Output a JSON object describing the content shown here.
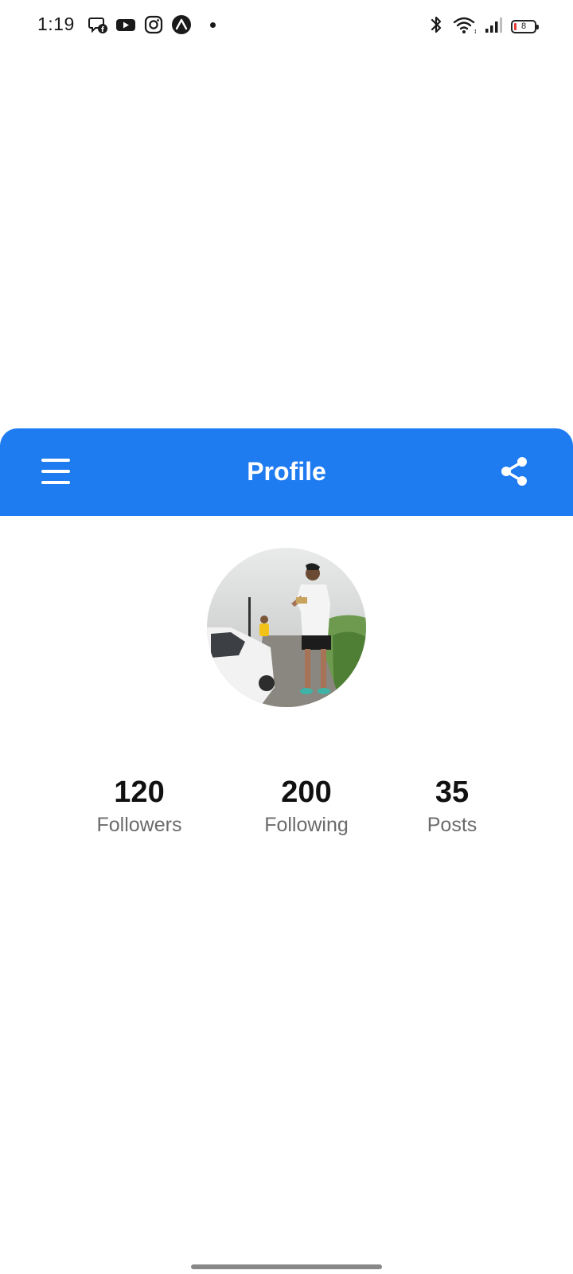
{
  "status_bar": {
    "time": "1:19",
    "battery_level": "8",
    "notification_icons": [
      "messenger-icon",
      "youtube-icon",
      "instagram-icon",
      "expo-icon"
    ],
    "system_icons": [
      "bluetooth-icon",
      "wifi-icon",
      "signal-icon",
      "battery-icon"
    ]
  },
  "app_bar": {
    "title": "Profile",
    "background_color": "#1e7bf0",
    "left_icon": "menu-icon",
    "right_icon": "share-icon"
  },
  "profile": {
    "avatar": "profile-photo"
  },
  "stats": [
    {
      "value": "120",
      "label": "Followers"
    },
    {
      "value": "200",
      "label": "Following"
    },
    {
      "value": "35",
      "label": "Posts"
    }
  ]
}
